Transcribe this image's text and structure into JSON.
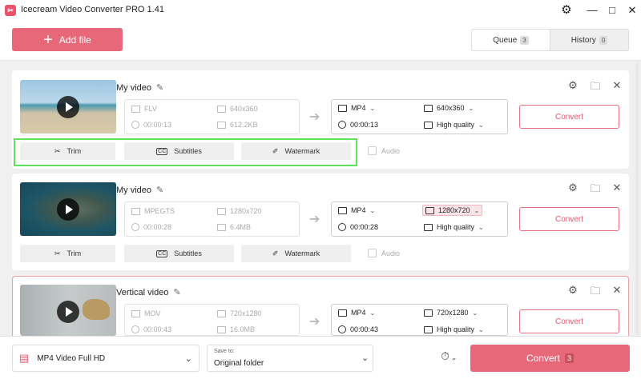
{
  "app": {
    "title": "Icecream Video Converter PRO 1.41"
  },
  "toolbar": {
    "add_file": "Add file"
  },
  "tabs": [
    {
      "label": "Queue",
      "count": "3",
      "active": true
    },
    {
      "label": "History",
      "count": "0",
      "active": false
    }
  ],
  "tools": {
    "trim": "Trim",
    "subtitles": "Subtitles",
    "watermark": "Watermark",
    "audio": "Audio"
  },
  "files": [
    {
      "name": "My video",
      "src_format": "FLV",
      "src_res": "640x360",
      "src_duration": "00:00:13",
      "src_size": "612.2KB",
      "dst_format": "MP4",
      "dst_res": "640x360",
      "dst_duration": "00:00:13",
      "dst_quality": "High quality",
      "convert": "Convert"
    },
    {
      "name": "My video",
      "src_format": "MPEGTS",
      "src_res": "1280x720",
      "src_duration": "00:00:28",
      "src_size": "6.4MB",
      "dst_format": "MP4",
      "dst_res": "1280x720",
      "dst_duration": "00:00:28",
      "dst_quality": "High quality",
      "convert": "Convert"
    },
    {
      "name": "Vertical video",
      "src_format": "MOV",
      "src_res": "720x1280",
      "src_duration": "00:00:43",
      "src_size": "16.0MB",
      "dst_format": "MP4",
      "dst_res": "720x1280",
      "dst_duration": "00:00:43",
      "dst_quality": "High quality",
      "convert": "Convert"
    }
  ],
  "bottom": {
    "preset": "MP4 Video Full HD",
    "save_to_label": "Save to:",
    "save_to_value": "Original folder",
    "convert_all": "Convert",
    "convert_count": "3"
  },
  "colors": {
    "accent": "#e66879",
    "highlight": "#5de25a"
  }
}
